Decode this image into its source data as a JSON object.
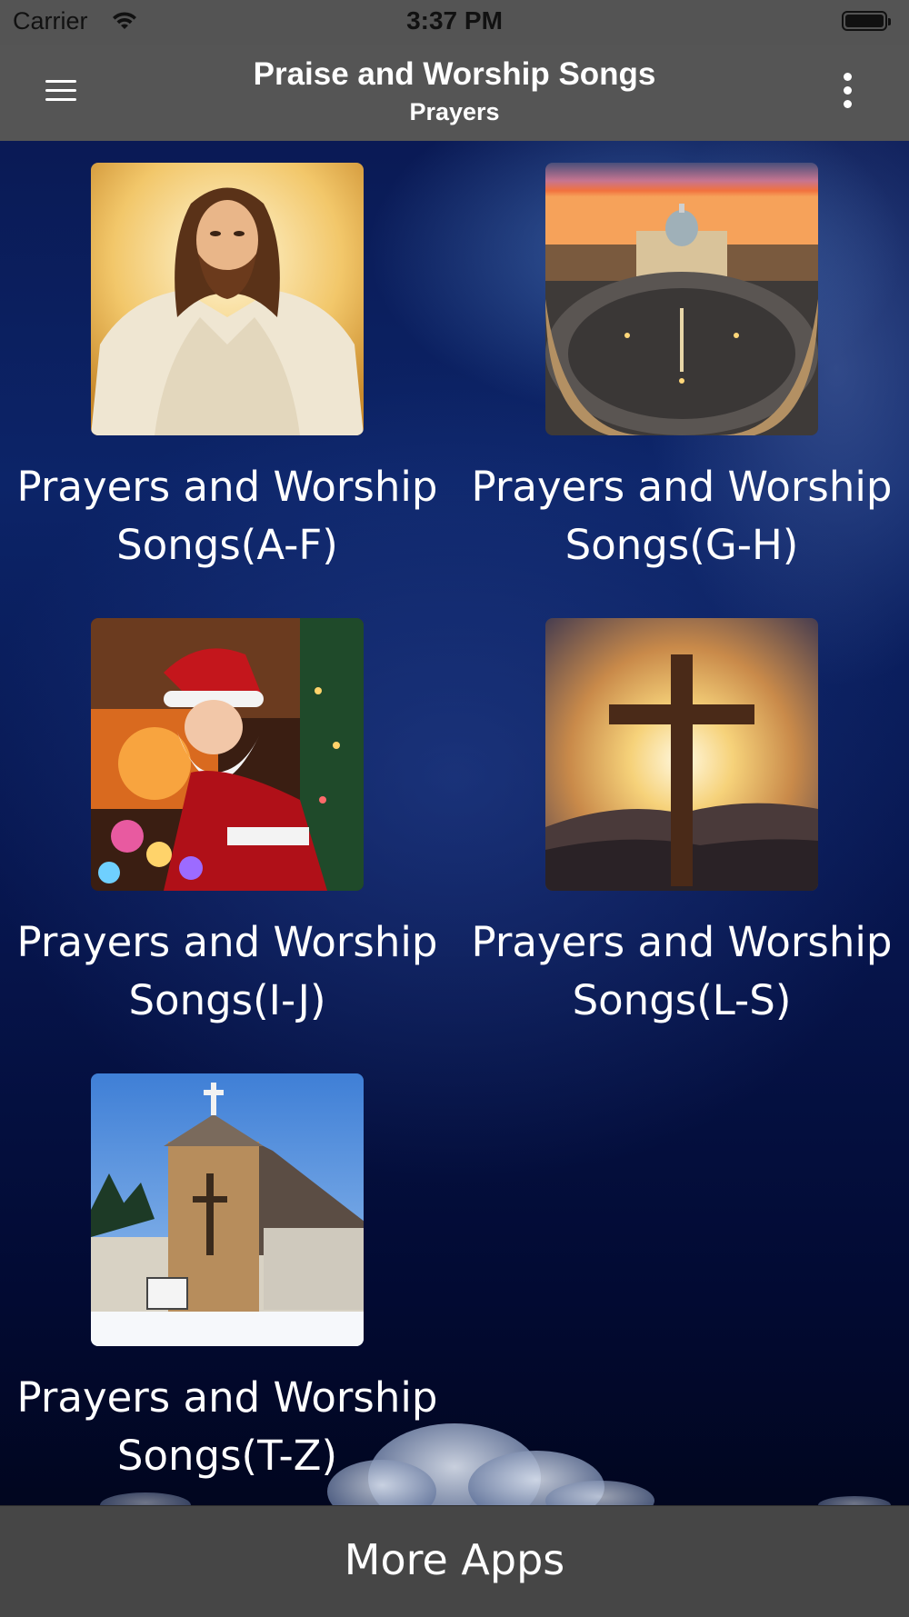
{
  "status_bar": {
    "carrier": "Carrier",
    "time": "3:37 PM"
  },
  "nav_bar": {
    "title": "Praise and Worship Songs",
    "subtitle": "Prayers"
  },
  "tiles": [
    {
      "label": "Prayers and Worship Songs(A-F)",
      "image": "jesus-portrait"
    },
    {
      "label": "Prayers and Worship Songs(G-H)",
      "image": "st-peters-square"
    },
    {
      "label": "Prayers and Worship Songs(I-J)",
      "image": "santa-claus"
    },
    {
      "label": "Prayers and Worship Songs(L-S)",
      "image": "cross-sunset"
    },
    {
      "label": "Prayers and Worship Songs(T-Z)",
      "image": "church-winter"
    }
  ],
  "bottom_bar": {
    "label": "More Apps"
  },
  "colors": {
    "bar_gray": "#555555",
    "bottom_bar": "#464646",
    "background_navy": "#0c2468"
  }
}
